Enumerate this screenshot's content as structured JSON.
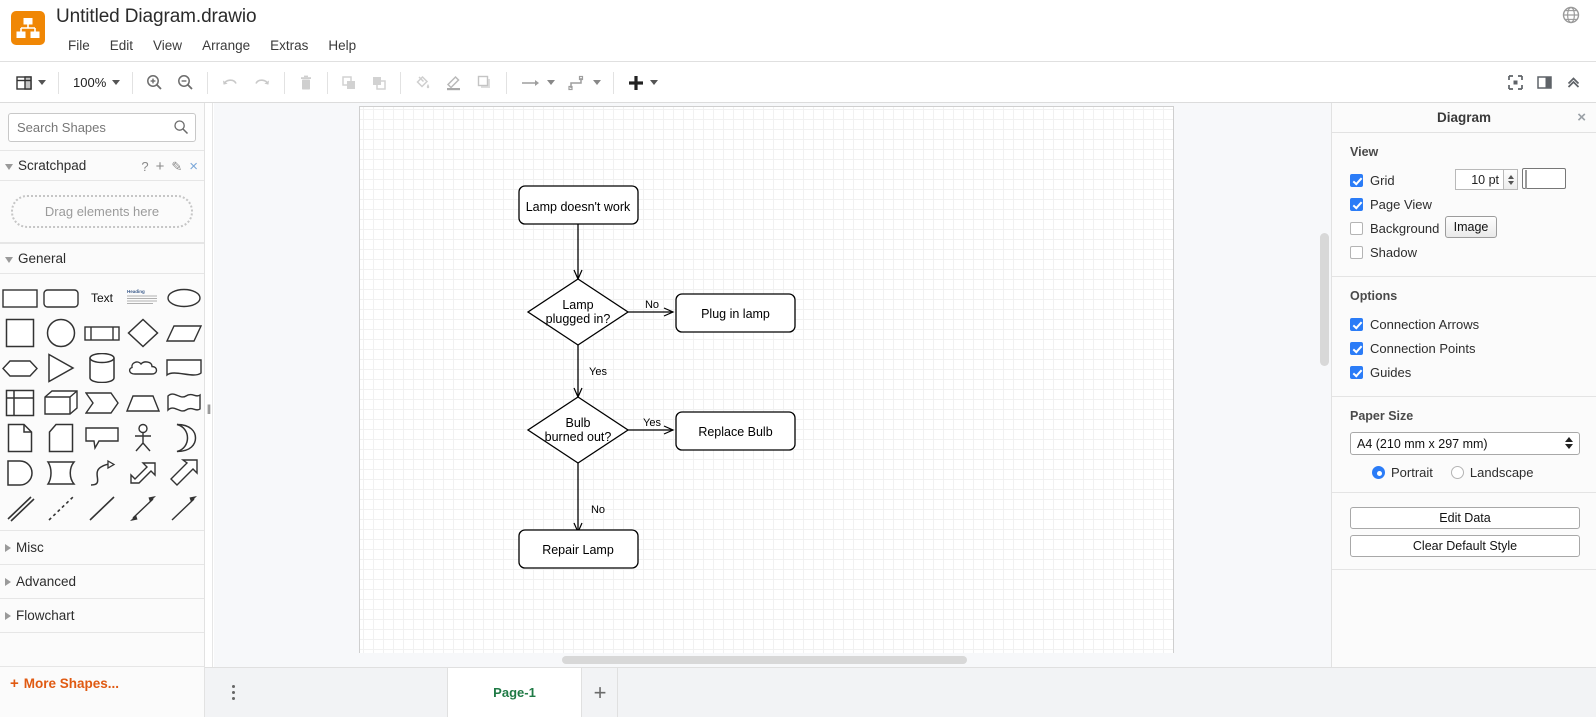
{
  "header": {
    "title": "Untitled Diagram.drawio",
    "logo_icon": "drawio-logo-icon",
    "globe_icon": "globe-language-icon",
    "menus": [
      "File",
      "Edit",
      "View",
      "Arrange",
      "Extras",
      "Help"
    ]
  },
  "toolbar": {
    "view_layers_icon": "view-layers-icon",
    "zoom_level": "100%",
    "zoom_in_icon": "zoom-in-icon",
    "zoom_out_icon": "zoom-out-icon",
    "undo_icon": "undo-icon",
    "redo_icon": "redo-icon",
    "delete_icon": "trash-delete-icon",
    "to_front_icon": "bring-to-front-icon",
    "to_back_icon": "send-to-back-icon",
    "fill_color_icon": "fill-color-bucket-icon",
    "line_color_icon": "line-color-pen-icon",
    "shadow_icon": "shadow-icon",
    "waypoints_icon": "arrow-connection-icon",
    "edge_style_icon": "edge-style-icon",
    "insert_icon": "insert-plus-icon",
    "fullscreen_icon": "fullscreen-icon",
    "format_panel_icon": "toggle-format-panel-icon",
    "collapse_icon": "collapse-toolbar-chevrons-icon"
  },
  "sidebar": {
    "search": {
      "placeholder": "Search Shapes",
      "value": "",
      "icon": "search-icon"
    },
    "scratchpad": {
      "label": "Scratchpad",
      "drop_text": "Drag elements here",
      "actions": [
        {
          "name": "help-icon",
          "glyph": "?"
        },
        {
          "name": "add-icon",
          "glyph": "+"
        },
        {
          "name": "edit-pencil-icon",
          "glyph": "✎"
        },
        {
          "name": "close-icon",
          "glyph": "×"
        }
      ]
    },
    "sections": [
      {
        "label": "General",
        "expanded": true
      },
      {
        "label": "Misc",
        "expanded": false
      },
      {
        "label": "Advanced",
        "expanded": false
      },
      {
        "label": "Flowchart",
        "expanded": false
      }
    ],
    "shapes": [
      "rectangle",
      "rounded-rectangle",
      "text",
      "textbox-heading",
      "ellipse",
      "square",
      "circle",
      "process",
      "rhombus-diamond",
      "parallelogram",
      "hexagon",
      "triangle",
      "cylinder",
      "cloud",
      "document",
      "internal-storage",
      "cube",
      "step",
      "trapezoid",
      "tape",
      "note",
      "card",
      "callout",
      "actor",
      "or-moon",
      "delay",
      "display",
      "curved-arrow",
      "bidirectional-block-arrow",
      "block-arrow",
      "double-line",
      "dashed-line",
      "line",
      "bidirectional-arrow",
      "directional-arrow"
    ],
    "shape_labels": {
      "text": "Text",
      "heading": "Heading"
    },
    "more_shapes": "More Shapes..."
  },
  "format_panel": {
    "title": "Diagram",
    "close_icon": "close-panel-icon",
    "view": {
      "heading": "View",
      "grid": {
        "label": "Grid",
        "checked": true,
        "size": "10 pt",
        "color": "#c8c8c8"
      },
      "page_view": {
        "label": "Page View",
        "checked": true
      },
      "background": {
        "label": "Background",
        "checked": false,
        "button": "Image"
      },
      "shadow": {
        "label": "Shadow",
        "checked": false
      }
    },
    "options": {
      "heading": "Options",
      "items": [
        {
          "label": "Connection Arrows",
          "checked": true
        },
        {
          "label": "Connection Points",
          "checked": true
        },
        {
          "label": "Guides",
          "checked": true
        }
      ]
    },
    "paper": {
      "heading": "Paper Size",
      "selected": "A4 (210 mm x 297 mm)",
      "orientation": [
        {
          "label": "Portrait",
          "selected": true
        },
        {
          "label": "Landscape",
          "selected": false
        }
      ]
    },
    "buttons": [
      "Edit Data",
      "Clear Default Style"
    ]
  },
  "footer": {
    "page_menu_icon": "page-menu-dots-icon",
    "pages": [
      {
        "label": "Page-1",
        "active": true
      }
    ],
    "add_page_icon": "add-page-icon",
    "add_page_glyph": "+"
  },
  "diagram": {
    "type": "flowchart",
    "nodes": [
      {
        "id": "n1",
        "shape": "rounded-rectangle",
        "label": "Lamp doesn't work"
      },
      {
        "id": "n2",
        "shape": "rhombus",
        "label": "Lamp\nplugged in?"
      },
      {
        "id": "n3",
        "shape": "rounded-rectangle",
        "label": "Plug in lamp"
      },
      {
        "id": "n4",
        "shape": "rhombus",
        "label": "Bulb\nburned out?"
      },
      {
        "id": "n5",
        "shape": "rounded-rectangle",
        "label": "Replace Bulb"
      },
      {
        "id": "n6",
        "shape": "rounded-rectangle",
        "label": "Repair Lamp"
      }
    ],
    "edges": [
      {
        "from": "n1",
        "to": "n2",
        "label": ""
      },
      {
        "from": "n2",
        "to": "n3",
        "label": "No"
      },
      {
        "from": "n2",
        "to": "n4",
        "label": "Yes"
      },
      {
        "from": "n4",
        "to": "n5",
        "label": "Yes"
      },
      {
        "from": "n4",
        "to": "n6",
        "label": "No"
      }
    ],
    "node_labels": {
      "n1": "Lamp doesn't work",
      "n2_line1": "Lamp",
      "n2_line2": "plugged in?",
      "n3": "Plug in lamp",
      "n4_line1": "Bulb",
      "n4_line2": "burned out?",
      "n5": "Replace Bulb",
      "n6": "Repair Lamp"
    },
    "edge_labels": {
      "e1": "No",
      "e2": "Yes",
      "e3": "Yes",
      "e4": "No"
    }
  },
  "colors": {
    "brand_orange": "#f08705",
    "accent_blue": "#2b7cf7",
    "page_tab_green": "#1f7a45",
    "more_shapes_orange": "#e05a12"
  }
}
